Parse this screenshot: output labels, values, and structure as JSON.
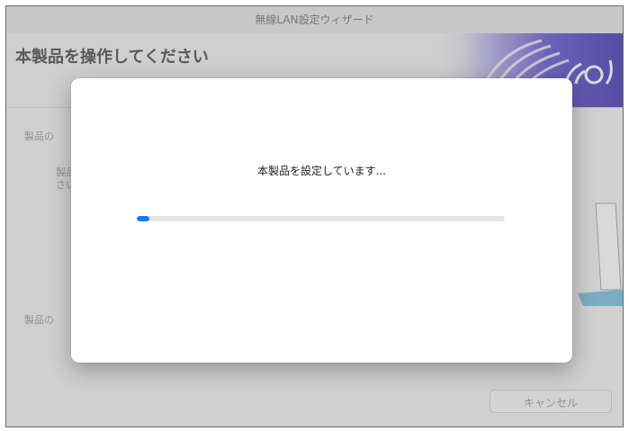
{
  "window": {
    "title": "無線LAN設定ウィザード"
  },
  "header": {
    "title": "本製品を操作してください"
  },
  "background_fragments": {
    "line1": "製品の",
    "line2a": "製品",
    "line2b": "さい",
    "line3": "製品の"
  },
  "footer": {
    "cancel_label": "キャンセル"
  },
  "modal": {
    "message": "本製品を設定しています...",
    "progress_fraction": 0.035
  },
  "colors": {
    "accent": "#1a7cf4",
    "header_art": "#5b46c6"
  }
}
